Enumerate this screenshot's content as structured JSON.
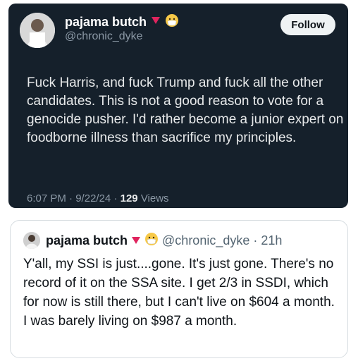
{
  "dark_post": {
    "display_name": "pajama butch",
    "handle": "@chronic_dyke",
    "follow_label": "Follow",
    "text": "Fuck Harris, and fuck Trump and fuck all the other candidates. This is not a good reason to vote for a genocide pusher. I'd rather become a junior expert on foodborne illness than sacrifice my principles.",
    "time": "6:07 PM",
    "sep1": "·",
    "date": "9/22/24",
    "sep2": "·",
    "views_count": "129",
    "views_label": "Views",
    "badge_icon": "red-triangle-icon",
    "emoji_icon": "face-with-medical-mask-icon"
  },
  "light_post": {
    "display_name": "pajama butch",
    "handle": "@chronic_dyke",
    "sep": "·",
    "age": "21h",
    "text": "Y'all, my SSI is just....gone. It's just gone. There's no record of it on the SSA site. I get 2/3 in SSDI, which for now is still there, but I can't live on $604 a month. I was barely living on $987 a month.",
    "badge_icon": "red-triangle-icon",
    "emoji_icon": "face-with-medical-mask-icon"
  },
  "colors": {
    "dark_bg": "#15202b",
    "dark_text": "#e7e9ea",
    "muted": "#8b98a5",
    "badge_red": "#e0245e"
  }
}
